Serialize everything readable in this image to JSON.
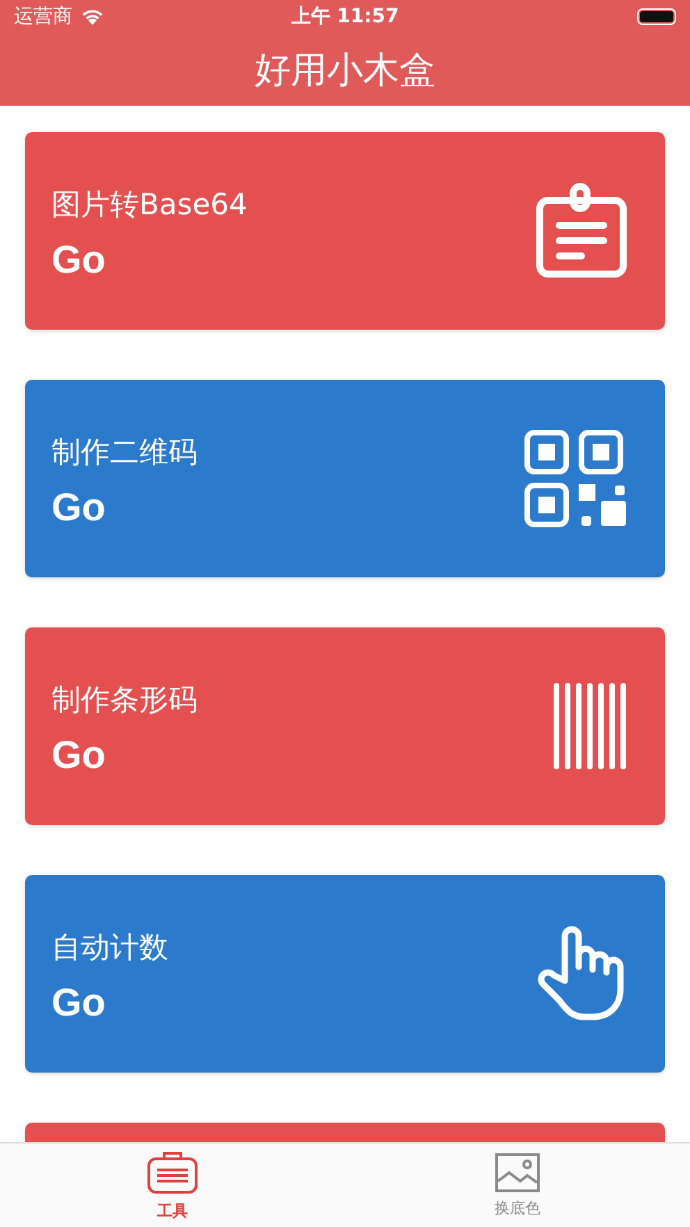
{
  "status_bar": {
    "carrier": "运营商",
    "time": "上午 11:57"
  },
  "nav_bar": {
    "title": "好用小木盒"
  },
  "cards": [
    {
      "title": "图片转Base64",
      "action": "Go",
      "color": "#e45050",
      "kind": "clipboard"
    },
    {
      "title": "制作二维码",
      "action": "Go",
      "color": "#2b7acb",
      "kind": "qrcode"
    },
    {
      "title": "制作条形码",
      "action": "Go",
      "color": "#e45050",
      "kind": "barcode"
    },
    {
      "title": "自动计数",
      "action": "Go",
      "color": "#2b7acb",
      "kind": "hand"
    },
    {
      "color": "#e45050"
    }
  ],
  "tab_bar": [
    {
      "label": "工具",
      "selected": true
    },
    {
      "label": "换底色",
      "selected": false
    }
  ]
}
